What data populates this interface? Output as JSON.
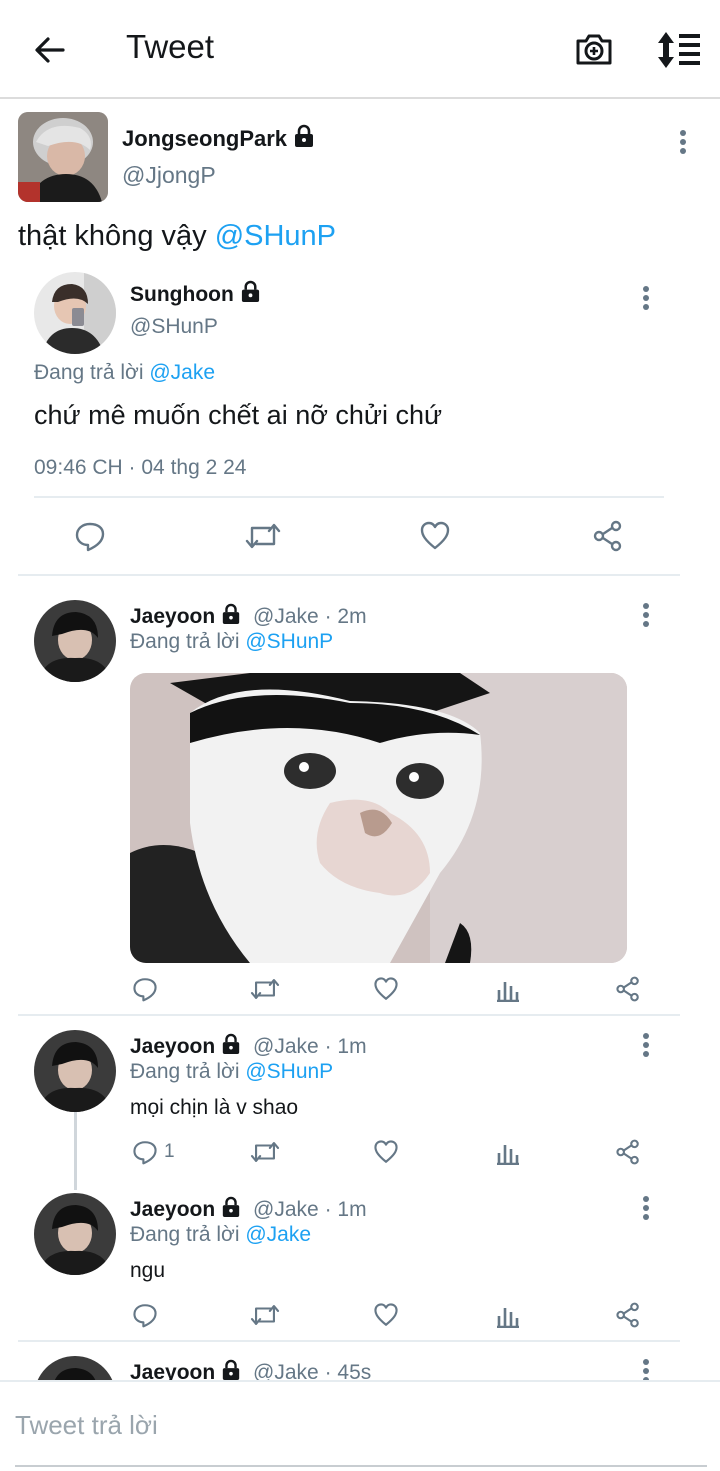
{
  "header": {
    "title": "Tweet",
    "back_icon": "arrow-left-icon",
    "camera_icon": "camera-add-icon",
    "sort_icon": "sort-order-icon"
  },
  "main_tweet": {
    "name": "JongseongPark",
    "handle": "@JjongP",
    "text": "thật không vậy ",
    "mention": "@SHunP"
  },
  "quoted": {
    "name": "Sunghoon",
    "handle": "@SHunP",
    "reply_prefix": "Đang trả lời ",
    "reply_to": "@Jake",
    "text": "chứ mê muốn chết ai nỡ chửi chứ",
    "timestamp": "09:46 CH · 04 thg 2 24"
  },
  "replies": [
    {
      "name": "Jaeyoon",
      "handle": "@Jake",
      "time": " · 2m",
      "reply_prefix": "Đang trả lời ",
      "reply_to": "@SHunP",
      "text": "",
      "reply_count": ""
    },
    {
      "name": "Jaeyoon",
      "handle": "@Jake",
      "time": " · 1m",
      "reply_prefix": "Đang trả lời ",
      "reply_to": "@SHunP",
      "text": "mọi chịn là v shao",
      "reply_count": "1"
    },
    {
      "name": "Jaeyoon",
      "handle": "@Jake",
      "time": " · 1m",
      "reply_prefix": "Đang trả lời ",
      "reply_to": "@Jake",
      "text": "ngu",
      "reply_count": ""
    },
    {
      "name": "Jaeyoon",
      "handle": "@Jake",
      "time": " · 45s"
    }
  ],
  "compose": {
    "placeholder": "Tweet trả lời"
  },
  "colors": {
    "link": "#1da1f2",
    "muted": "#657786",
    "icon": "#657786"
  }
}
